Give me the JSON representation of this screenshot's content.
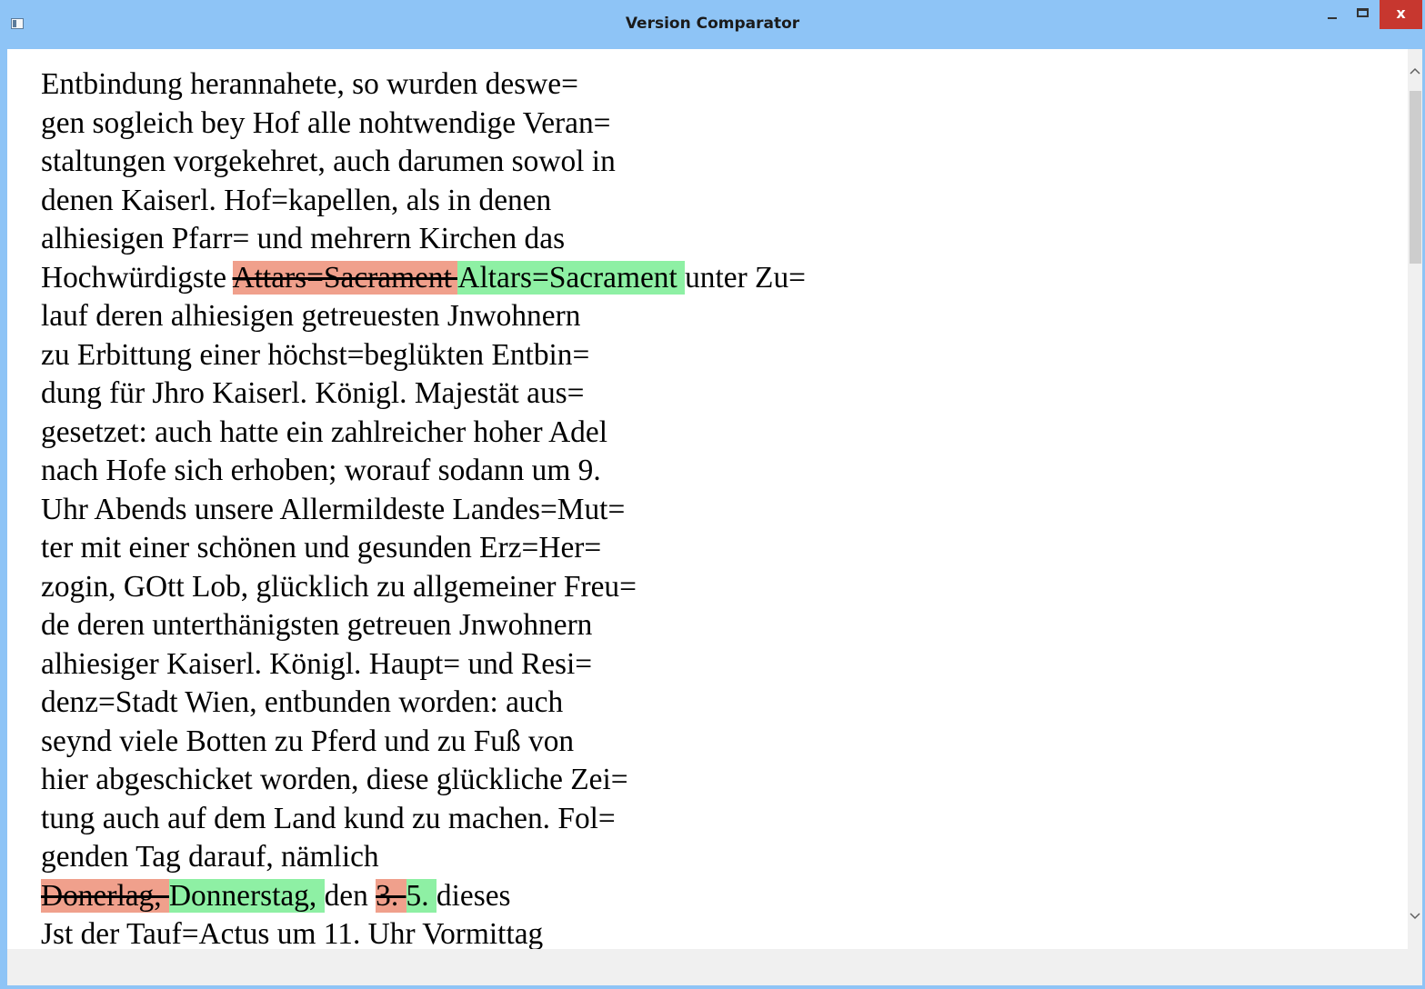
{
  "window": {
    "title": "Version Comparator",
    "minimize_glyph": "",
    "maximize_glyph": "",
    "close_glyph": "x"
  },
  "colors": {
    "titlebar": "#8ec4f6",
    "deleted_highlight": "#f0a08c",
    "inserted_highlight": "#8ef0a4",
    "close_button": "#c7372f"
  },
  "document": {
    "lines": [
      [
        {
          "type": "text",
          "text": "Entbindung herannahete, so wurden deswe="
        }
      ],
      [
        {
          "type": "text",
          "text": "gen sogleich bey Hof alle nohtwendige Veran="
        }
      ],
      [
        {
          "type": "text",
          "text": "staltungen vorgekehret, auch darumen sowol in"
        }
      ],
      [
        {
          "type": "text",
          "text": "denen Kaiserl. Hof=kapellen, als in denen"
        }
      ],
      [
        {
          "type": "text",
          "text": "alhiesigen Pfarr= und mehrern Kirchen das"
        }
      ],
      [
        {
          "type": "text",
          "text": "Hochwürdigste "
        },
        {
          "type": "del",
          "text": "Attars=Sacrament "
        },
        {
          "type": "ins",
          "text": "Altars=Sacrament "
        },
        {
          "type": "text",
          "text": "unter Zu="
        }
      ],
      [
        {
          "type": "text",
          "text": "lauf deren alhiesigen getreuesten Jnwohnern"
        }
      ],
      [
        {
          "type": "text",
          "text": "zu Erbittung einer höchst=beglükten Entbin="
        }
      ],
      [
        {
          "type": "text",
          "text": "dung für Jhro Kaiserl. Königl. Majestät aus="
        }
      ],
      [
        {
          "type": "text",
          "text": "gesetzet: auch hatte ein zahlreicher hoher Adel"
        }
      ],
      [
        {
          "type": "text",
          "text": "nach Hofe sich erhoben; worauf sodann um 9."
        }
      ],
      [
        {
          "type": "text",
          "text": "Uhr Abends unsere Allermildeste Landes=Mut="
        }
      ],
      [
        {
          "type": "text",
          "text": "ter mit einer schönen und gesunden Erz=Her="
        }
      ],
      [
        {
          "type": "text",
          "text": "zogin, GOtt Lob, glücklich zu allgemeiner Freu="
        }
      ],
      [
        {
          "type": "text",
          "text": "de deren unterthänigsten getreuen Jnwohnern"
        }
      ],
      [
        {
          "type": "text",
          "text": "alhiesiger Kaiserl. Königl. Haupt= und Resi="
        }
      ],
      [
        {
          "type": "text",
          "text": "denz=Stadt Wien, entbunden worden: auch"
        }
      ],
      [
        {
          "type": "text",
          "text": "seynd viele Botten zu Pferd und zu Fuß von"
        }
      ],
      [
        {
          "type": "text",
          "text": "hier abgeschicket worden, diese glückliche Zei="
        }
      ],
      [
        {
          "type": "text",
          "text": "tung auch auf dem Land kund zu machen. Fol="
        }
      ],
      [
        {
          "type": "text",
          "text": "genden Tag darauf, nämlich"
        }
      ],
      [
        {
          "type": "del",
          "text": "Donerlag, "
        },
        {
          "type": "ins",
          "text": "Donnerstag, "
        },
        {
          "type": "text",
          "text": "den "
        },
        {
          "type": "del",
          "text": "3. "
        },
        {
          "type": "ins",
          "text": "5. "
        },
        {
          "type": "text",
          "text": "dieses"
        }
      ],
      [
        {
          "type": "text",
          "text": "Jst der Tauf=Actus um 11. Uhr Vormittag"
        }
      ]
    ]
  },
  "scrollbar": {
    "up_icon": "chevron-up-icon",
    "down_icon": "chevron-down-icon",
    "up_glyph": "^",
    "down_glyph": "v"
  },
  "icons": {
    "app_icon": "window-app-icon"
  }
}
